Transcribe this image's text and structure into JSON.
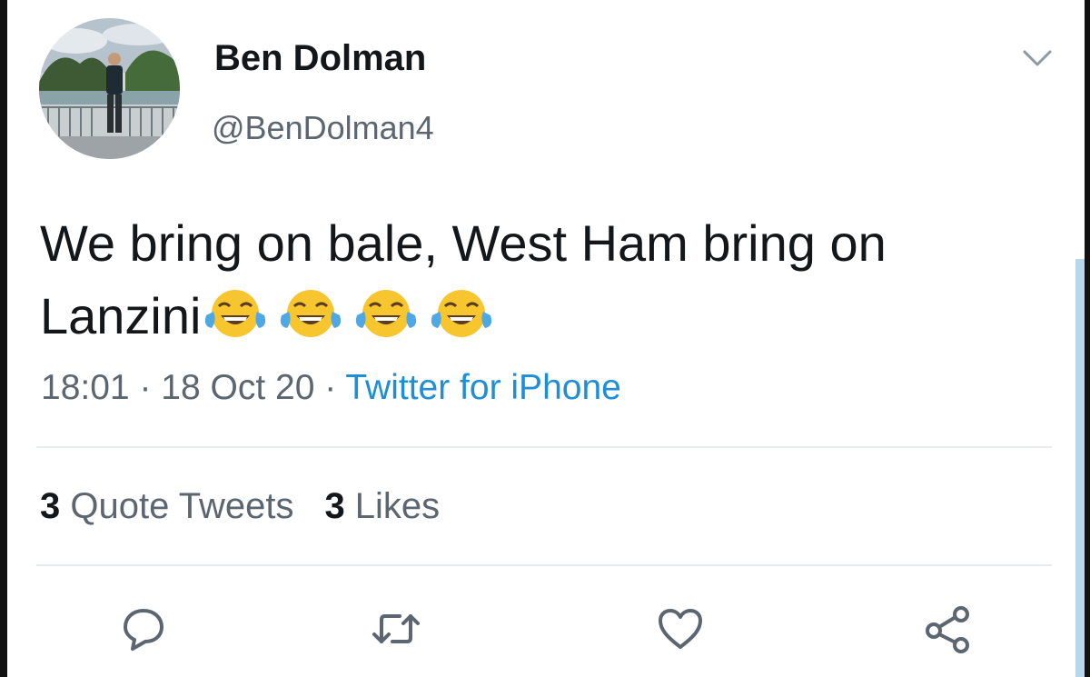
{
  "tweet": {
    "display_name": "Ben Dolman",
    "handle": "@BenDolman4",
    "text_line1": "We bring on bale, West Ham bring on",
    "text_line2": "Lanzini",
    "emojis": [
      "face-with-tears-of-joy-icon",
      "face-with-tears-of-joy-icon",
      "face-with-tears-of-joy-icon",
      "face-with-tears-of-joy-icon"
    ],
    "time": "18:01",
    "separator": " · ",
    "date": "18 Oct 20",
    "source": "Twitter for iPhone"
  },
  "stats": {
    "quote_tweets_count": "3",
    "quote_tweets_label": " Quote Tweets",
    "likes_count": "3",
    "likes_label": " Likes"
  },
  "actions": [
    "reply-icon",
    "retweet-icon",
    "like-icon",
    "share-icon"
  ],
  "colors": {
    "text": "#14171a",
    "secondary": "#5b6670",
    "link": "#1d8fd6",
    "divider": "#e6ecf0",
    "emoji": "#f7c52e"
  }
}
